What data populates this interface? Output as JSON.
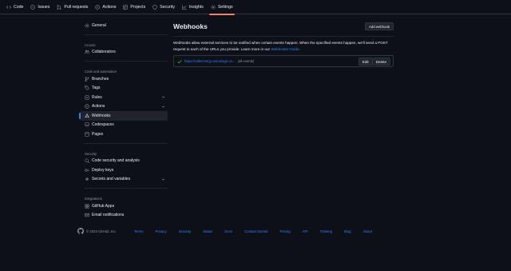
{
  "repo_nav": {
    "tabs": [
      {
        "label": "Code",
        "icon": "code-icon"
      },
      {
        "label": "Issues",
        "icon": "issue-icon"
      },
      {
        "label": "Pull requests",
        "icon": "pull-request-icon"
      },
      {
        "label": "Actions",
        "icon": "play-icon"
      },
      {
        "label": "Projects",
        "icon": "table-icon"
      },
      {
        "label": "Security",
        "icon": "shield-icon"
      },
      {
        "label": "Insights",
        "icon": "graph-icon"
      },
      {
        "label": "Settings",
        "icon": "gear-icon",
        "active": true
      }
    ]
  },
  "sidebar": {
    "general": "General",
    "access_heading": "Access",
    "collaborators": "Collaborators",
    "code_heading": "Code and automation",
    "branches": "Branches",
    "tags": "Tags",
    "rules": "Rules",
    "actions": "Actions",
    "webhooks": "Webhooks",
    "codespaces": "Codespaces",
    "pages": "Pages",
    "security_heading": "Security",
    "code_security": "Code security and analysis",
    "deploy_keys": "Deploy keys",
    "secrets": "Secrets and variables",
    "integrations_heading": "Integrations",
    "github_apps": "GitHub Apps",
    "email_notifications": "Email notifications"
  },
  "main": {
    "title": "Webhooks",
    "add_button": "Add webhook",
    "description": "Webhooks allow external services to be notified when certain events happen. When the specified events happen, we'll send a POST request to each of the URLs you provide. Learn more in our ",
    "guide_link": "Webhooks Guide",
    "description_end": ".",
    "webhook": {
      "url": "https://collectors.jp.sumologic.co...",
      "events": "(all events)",
      "edit": "Edit",
      "delete": "Delete"
    }
  },
  "footer": {
    "copyright": "© 2023 GitHub, Inc.",
    "links": [
      "Terms",
      "Privacy",
      "Security",
      "Status",
      "Docs",
      "Contact GitHub",
      "Pricing",
      "API",
      "Training",
      "Blog",
      "About"
    ]
  },
  "colors": {
    "background": "#0d1117",
    "border": "#30363d",
    "link": "#2f81f7",
    "active_tab_underline": "#f78166",
    "success": "#3fb950"
  }
}
